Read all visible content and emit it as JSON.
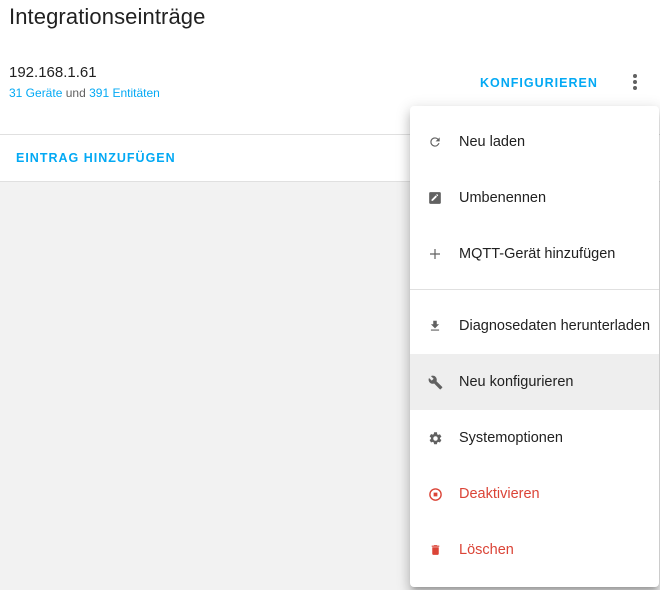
{
  "card": {
    "title": "Integrationseinträge"
  },
  "entry": {
    "host": "192.168.1.61",
    "devices_link": "31 Geräte",
    "connector": "und",
    "entities_link": "391 Entitäten",
    "configure_label": "KONFIGURIEREN"
  },
  "actions": {
    "add_entry_label": "EINTRAG HINZUFÜGEN"
  },
  "menu": {
    "items": [
      {
        "label": "Neu laden",
        "icon": "reload-icon"
      },
      {
        "label": "Umbenennen",
        "icon": "rename-icon"
      },
      {
        "label": "MQTT-Gerät hinzufügen",
        "icon": "plus-icon"
      },
      {
        "label": "Diagnosedaten herunterladen",
        "icon": "download-icon"
      },
      {
        "label": "Neu konfigurieren",
        "icon": "wrench-icon"
      },
      {
        "label": "Systemoptionen",
        "icon": "gear-icon"
      },
      {
        "label": "Deaktivieren",
        "icon": "stop-circle-icon"
      },
      {
        "label": "Löschen",
        "icon": "trash-icon"
      }
    ]
  },
  "colors": {
    "accent": "#03a9f4",
    "danger": "#db4437",
    "icon": "#616161"
  }
}
